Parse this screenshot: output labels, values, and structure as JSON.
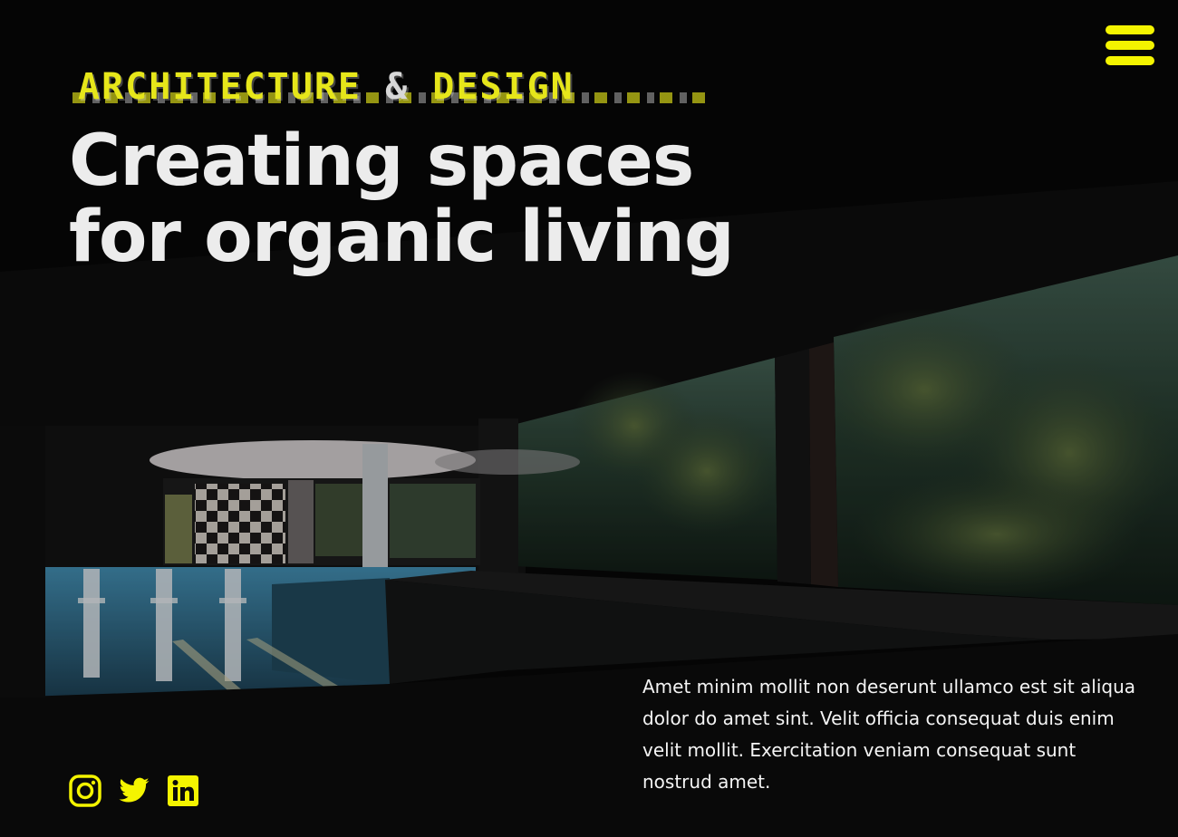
{
  "header": {
    "kicker": "ARCHITECTURE",
    "kicker_amp": "&",
    "kicker_second": "DESIGN",
    "menu_icon": "hamburger-menu-icon"
  },
  "hero": {
    "headline_line1": "Creating spaces",
    "headline_line2": "for organic living",
    "description": "Amet minim mollit non deserunt ullamco est sit aliqua dolor do amet sint. Velit officia consequat duis enim velit mollit. Exercitation veniam consequat sunt nostrud amet.",
    "background_image": "abandoned-indoor-pool-with-windows-to-forest"
  },
  "social": {
    "icons": [
      "instagram-icon",
      "twitter-icon",
      "linkedin-icon"
    ]
  },
  "colors": {
    "accent": "#f4f400",
    "background": "#060606",
    "text": "#ececec"
  }
}
